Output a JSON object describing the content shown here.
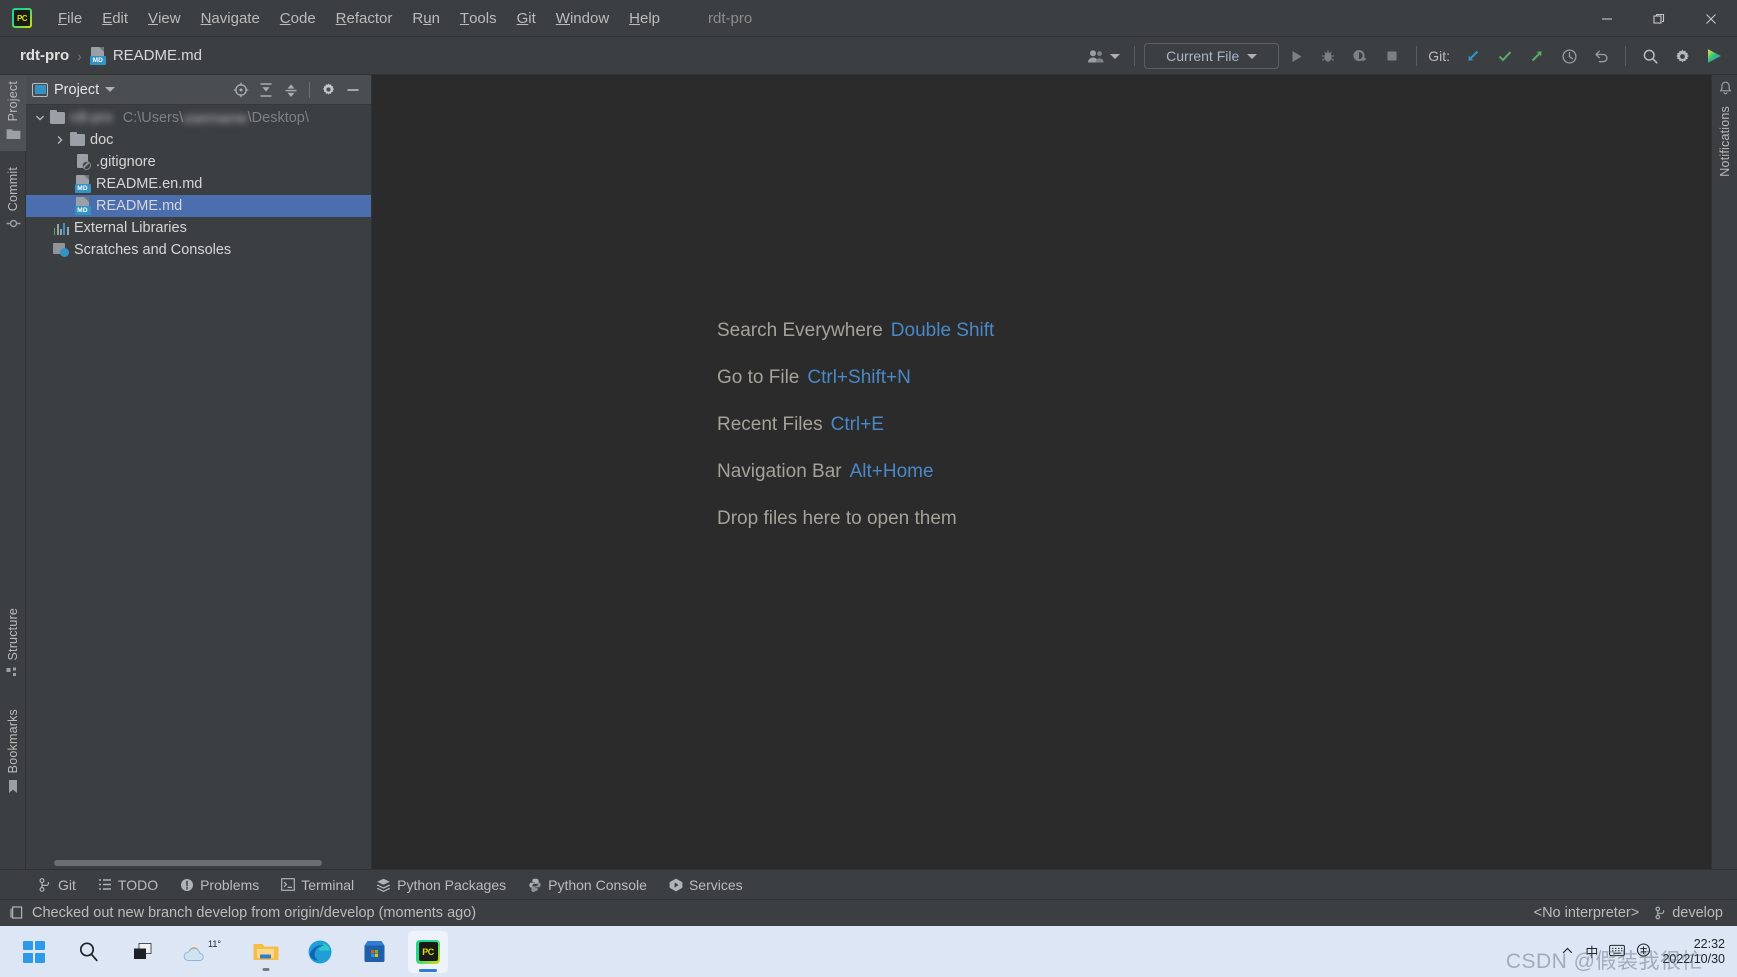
{
  "window": {
    "title": "rdt-pro",
    "app_icon": "pycharm-logo-icon",
    "controls": {
      "minimize": "minimize-icon",
      "restore": "restore-icon",
      "close": "close-icon"
    }
  },
  "menubar": {
    "items": [
      {
        "label": "File",
        "mnemonic": "F"
      },
      {
        "label": "Edit",
        "mnemonic": "E"
      },
      {
        "label": "View",
        "mnemonic": "V"
      },
      {
        "label": "Navigate",
        "mnemonic": "N"
      },
      {
        "label": "Code",
        "mnemonic": "C"
      },
      {
        "label": "Refactor",
        "mnemonic": "R"
      },
      {
        "label": "Run",
        "mnemonic": "u"
      },
      {
        "label": "Tools",
        "mnemonic": "T"
      },
      {
        "label": "Git",
        "mnemonic": "G"
      },
      {
        "label": "Window",
        "mnemonic": "W"
      },
      {
        "label": "Help",
        "mnemonic": "H"
      }
    ]
  },
  "navbar": {
    "breadcrumbs": [
      {
        "label": "rdt-pro",
        "icon": ""
      },
      {
        "label": "README.md",
        "icon": "markdown-file-icon",
        "icon_tag": "MD"
      }
    ],
    "separator": "›",
    "run_config": "Current File",
    "git_label": "Git:",
    "actions": [
      "user-accounts-icon",
      "run-icon",
      "debug-icon",
      "run-with-coverage-icon",
      "stop-icon",
      "git-update-project-icon",
      "git-commit-icon",
      "git-push-icon",
      "history-icon",
      "rollback-icon",
      "search-icon",
      "settings-gear-icon",
      "run-anything-icon"
    ]
  },
  "left_stripe": {
    "top": [
      {
        "label": "Project",
        "icon": "project-folder-icon",
        "active": true
      },
      {
        "label": "Commit",
        "icon": "commit-icon",
        "active": false
      }
    ],
    "bottom": [
      {
        "label": "Structure",
        "icon": "structure-icon",
        "active": false
      },
      {
        "label": "Bookmarks",
        "icon": "bookmark-icon",
        "active": false
      }
    ]
  },
  "right_stripe": {
    "items": [
      {
        "label": "Notifications",
        "icon": "notifications-bell-icon"
      }
    ]
  },
  "project_panel": {
    "title": "Project",
    "title_icon": "project-window-icon",
    "actions": [
      "select-opened-file-icon",
      "expand-all-icon",
      "collapse-all-icon",
      "options-gear-icon",
      "hide-icon"
    ],
    "tree": [
      {
        "label": "",
        "label_blurred": "rdt-pro",
        "path_prefix": "C:\\Users\\",
        "path_blurred": "username",
        "path_suffix": "\\Desktop\\",
        "icon": "folder-icon",
        "indent": 0,
        "expanded": true,
        "has_arrow": true,
        "selected": false,
        "dim": true
      },
      {
        "label": "doc",
        "icon": "folder-icon",
        "indent": 1,
        "expanded": false,
        "has_arrow": true,
        "selected": false
      },
      {
        "label": ".gitignore",
        "icon": "gitignore-file-icon",
        "indent": 2,
        "has_arrow": false,
        "selected": false
      },
      {
        "label": "README.en.md",
        "icon": "markdown-file-icon",
        "icon_tag": "MD",
        "indent": 2,
        "has_arrow": false,
        "selected": false
      },
      {
        "label": "README.md",
        "icon": "markdown-file-icon",
        "icon_tag": "MD",
        "indent": 2,
        "has_arrow": false,
        "selected": true
      },
      {
        "label": "External Libraries",
        "icon": "external-libraries-icon",
        "indent": 1,
        "has_arrow": false,
        "selected": false
      },
      {
        "label": "Scratches and Consoles",
        "icon": "scratches-icon",
        "indent": 1,
        "has_arrow": false,
        "selected": false
      }
    ]
  },
  "editor": {
    "hints": [
      {
        "action": "Search Everywhere",
        "shortcut": "Double Shift"
      },
      {
        "action": "Go to File",
        "shortcut": "Ctrl+Shift+N"
      },
      {
        "action": "Recent Files",
        "shortcut": "Ctrl+E"
      },
      {
        "action": "Navigation Bar",
        "shortcut": "Alt+Home"
      },
      {
        "action": "Drop files here to open them",
        "shortcut": ""
      }
    ]
  },
  "bottom_bar": {
    "items": [
      {
        "label": "Git",
        "icon": "git-branch-icon"
      },
      {
        "label": "TODO",
        "icon": "todo-list-icon"
      },
      {
        "label": "Problems",
        "icon": "problems-warning-icon"
      },
      {
        "label": "Terminal",
        "icon": "terminal-icon"
      },
      {
        "label": "Python Packages",
        "icon": "python-packages-icon"
      },
      {
        "label": "Python Console",
        "icon": "python-console-icon"
      },
      {
        "label": "Services",
        "icon": "services-icon"
      }
    ]
  },
  "status_bar": {
    "message": "Checked out new branch develop from origin/develop (moments ago)",
    "message_icon": "event-log-icon",
    "interpreter": "<No interpreter>",
    "branch": "develop",
    "branch_icon": "git-branch-icon"
  },
  "taskbar": {
    "items": [
      {
        "name": "start-button",
        "icon": "windows-start-icon"
      },
      {
        "name": "search-button",
        "icon": "search-icon"
      },
      {
        "name": "task-view-button",
        "icon": "task-view-icon"
      },
      {
        "name": "weather-widget",
        "icon": "weather-sun-cloud-icon",
        "label": "11°"
      },
      {
        "name": "file-explorer-button",
        "icon": "file-explorer-icon"
      },
      {
        "name": "edge-button",
        "icon": "microsoft-edge-icon"
      },
      {
        "name": "microsoft-store-button",
        "icon": "microsoft-store-icon"
      },
      {
        "name": "pycharm-button",
        "icon": "pycharm-logo-icon"
      }
    ],
    "tray": {
      "chevron": "show-hidden-icons-icon",
      "ime": "中",
      "ime_secondary": "⌨",
      "time": "22:32",
      "date": "2022/10/30"
    },
    "watermark": "CSDN @假装我很忙"
  }
}
